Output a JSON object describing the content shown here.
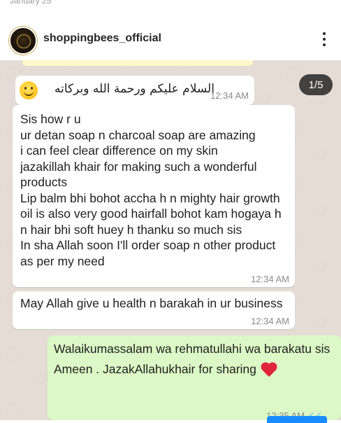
{
  "header": {
    "date": "January 25",
    "username": "shoppingbees_official",
    "more_icon": "more-vertical-icon"
  },
  "carousel": {
    "counter": "1/5"
  },
  "messages": [
    {
      "direction": "incoming",
      "emoji": "smiling-face-icon",
      "text": "السلام علیکم ورحمة الله وبرکاته",
      "time": "12:34 AM"
    },
    {
      "direction": "incoming",
      "text": "Sis how r u\nur detan soap n  charcoal soap  are amazing\ni can feel clear difference on my skin\njazakillah khair for making such a wonderful products\nLip balm bhi bohot accha h n mighty hair growth oil is also very good hairfall bohot kam hogaya h n hair bhi soft huey h thanku so much sis\nIn sha Allah soon  I'll order soap n other product as per my need",
      "time": "12:34 AM"
    },
    {
      "direction": "incoming",
      "text": "May Allah give u health n barakah in ur business",
      "time": "12:34 AM"
    },
    {
      "direction": "outgoing",
      "text": "Walaikumassalam wa rehmatullahi wa barakatu sis",
      "text2": "Ameen . JazakAllahukhair for sharing",
      "emoji": "red-heart-icon",
      "time": "12:35 AM",
      "status_icon": "double-check-icon"
    }
  ],
  "colors": {
    "chat_bg": "#e5ddd5",
    "incoming_bubble": "#ffffff",
    "outgoing_bubble": "#dcf8c6",
    "read_check": "#4fc3f7"
  }
}
